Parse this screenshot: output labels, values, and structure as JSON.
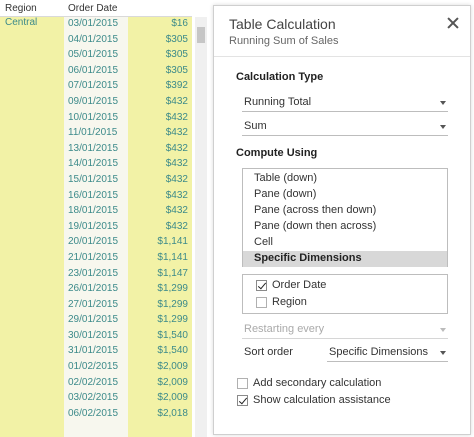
{
  "sheet": {
    "headers": {
      "region": "Region",
      "order_date": "Order Date"
    },
    "region_value": "Central",
    "rows": [
      {
        "date": "03/01/2015",
        "sales": "$16"
      },
      {
        "date": "04/01/2015",
        "sales": "$305"
      },
      {
        "date": "05/01/2015",
        "sales": "$305"
      },
      {
        "date": "06/01/2015",
        "sales": "$305"
      },
      {
        "date": "07/01/2015",
        "sales": "$392"
      },
      {
        "date": "09/01/2015",
        "sales": "$432"
      },
      {
        "date": "10/01/2015",
        "sales": "$432"
      },
      {
        "date": "11/01/2015",
        "sales": "$432"
      },
      {
        "date": "13/01/2015",
        "sales": "$432"
      },
      {
        "date": "14/01/2015",
        "sales": "$432"
      },
      {
        "date": "15/01/2015",
        "sales": "$432"
      },
      {
        "date": "16/01/2015",
        "sales": "$432"
      },
      {
        "date": "18/01/2015",
        "sales": "$432"
      },
      {
        "date": "19/01/2015",
        "sales": "$432"
      },
      {
        "date": "20/01/2015",
        "sales": "$1,141"
      },
      {
        "date": "21/01/2015",
        "sales": "$1,141"
      },
      {
        "date": "23/01/2015",
        "sales": "$1,147"
      },
      {
        "date": "26/01/2015",
        "sales": "$1,299"
      },
      {
        "date": "27/01/2015",
        "sales": "$1,299"
      },
      {
        "date": "29/01/2015",
        "sales": "$1,299"
      },
      {
        "date": "30/01/2015",
        "sales": "$1,540"
      },
      {
        "date": "31/01/2015",
        "sales": "$1,540"
      },
      {
        "date": "01/02/2015",
        "sales": "$2,009"
      },
      {
        "date": "02/02/2015",
        "sales": "$2,009"
      },
      {
        "date": "03/02/2015",
        "sales": "$2,009"
      },
      {
        "date": "06/02/2015",
        "sales": "$2,018"
      }
    ]
  },
  "dialog": {
    "title": "Table Calculation",
    "subtitle": "Running Sum of Sales",
    "calc_type_label": "Calculation Type",
    "calc_type_value": "Running Total",
    "aggregation_value": "Sum",
    "compute_using_label": "Compute Using",
    "compute_options": [
      "Table (down)",
      "Pane (down)",
      "Pane (across then down)",
      "Pane (down then across)",
      "Cell",
      "Specific Dimensions"
    ],
    "selected_compute_option": "Specific Dimensions",
    "dimensions": [
      {
        "label": "Order Date",
        "checked": true
      },
      {
        "label": "Region",
        "checked": false
      }
    ],
    "restarting_every_label": "Restarting every",
    "sort_order_label": "Sort order",
    "sort_order_value": "Specific Dimensions",
    "secondary_calc_label": "Add secondary calculation",
    "secondary_calc_checked": false,
    "show_assistance_label": "Show calculation assistance",
    "show_assistance_checked": true
  }
}
